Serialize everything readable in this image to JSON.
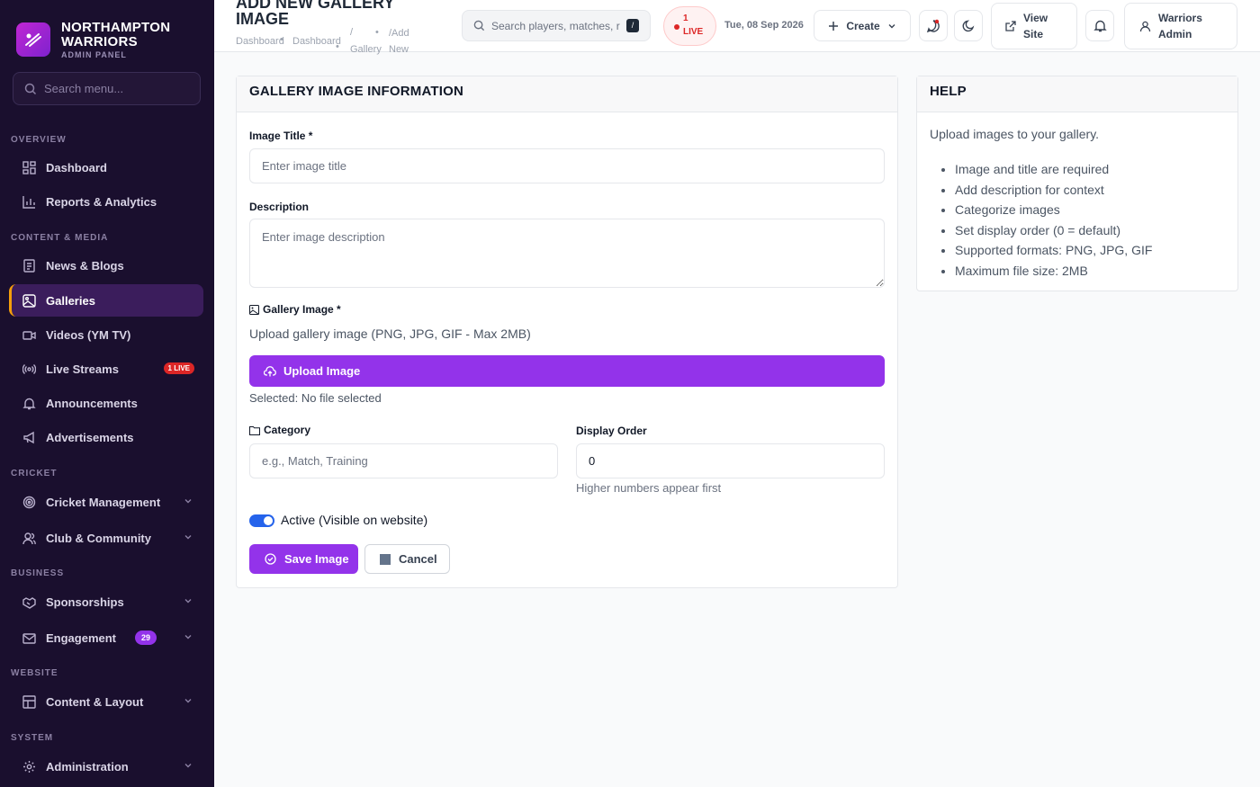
{
  "brand": {
    "name": "NORTHAMPTON WARRIORS",
    "subtitle": "ADMIN PANEL"
  },
  "sidebar": {
    "search_placeholder": "Search menu...",
    "sections": [
      {
        "label": "OVERVIEW"
      },
      {
        "label": "CONTENT & MEDIA"
      },
      {
        "label": "CRICKET"
      },
      {
        "label": "BUSINESS"
      },
      {
        "label": "WEBSITE"
      },
      {
        "label": "SYSTEM"
      }
    ],
    "items": [
      {
        "label": "Dashboard",
        "icon": "grid-icon"
      },
      {
        "label": "Reports & Analytics",
        "icon": "bar-chart-icon"
      },
      {
        "label": "News & Blogs",
        "icon": "newspaper-icon"
      },
      {
        "label": "Galleries",
        "icon": "image-icon",
        "active": true
      },
      {
        "label": "Videos (YM TV)",
        "icon": "video-icon"
      },
      {
        "label": "Live Streams",
        "icon": "broadcast-icon",
        "badge": "1 LIVE"
      },
      {
        "label": "Announcements",
        "icon": "bell-icon"
      },
      {
        "label": "Advertisements",
        "icon": "megaphone-icon"
      },
      {
        "label": "Cricket Management",
        "icon": "target-icon"
      },
      {
        "label": "Club & Community",
        "icon": "users-icon"
      },
      {
        "label": "Sponsorships",
        "icon": "handshake-icon"
      },
      {
        "label": "Engagement",
        "icon": "mail-icon",
        "badge": "29"
      },
      {
        "label": "Content & Layout",
        "icon": "layout-icon"
      },
      {
        "label": "Administration",
        "icon": "gear-icon"
      }
    ]
  },
  "header": {
    "title": "ADD NEW GALLERY IMAGE",
    "breadcrumbs": [
      "Dashboard",
      "Dashboard",
      "/",
      "Gallery",
      "/Add",
      "New"
    ],
    "search_placeholder": "Search players, matches, r",
    "search_shortcut": "/",
    "live_count": "1",
    "live_label": "LIVE",
    "date": "Tue, 08 Sep 2026",
    "create_label": "Create",
    "view_site_label": "View Site",
    "user_label": "Warriors Admin"
  },
  "form": {
    "heading": "GALLERY IMAGE INFORMATION",
    "title_label": "Image Title *",
    "title_placeholder": "Enter image title",
    "description_label": "Description",
    "description_placeholder": "Enter image description",
    "image_label": "Gallery Image *",
    "image_hint": "Upload gallery image (PNG, JPG, GIF - Max 2MB)",
    "upload_label": "Upload Image",
    "selected_text": "Selected: No file selected",
    "category_label": "Category",
    "category_placeholder": "e.g., Match, Training",
    "order_label": "Display Order",
    "order_value": "0",
    "order_hint": "Higher numbers appear first",
    "active_label": "Active (Visible on website)",
    "active": true,
    "save_label": "Save Image",
    "cancel_label": "Cancel"
  },
  "help": {
    "heading": "HELP",
    "intro": "Upload images to your gallery.",
    "tips": [
      "Image and title are required",
      "Add description for context",
      "Categorize images",
      "Set display order (0 = default)",
      "Supported formats: PNG, JPG, GIF",
      "Maximum file size: 2MB"
    ]
  },
  "colors": {
    "accent": "#9333ea",
    "sidebar_bg": "#1a0f2e",
    "live": "#dc2626",
    "active_marker": "#f59e0b"
  }
}
